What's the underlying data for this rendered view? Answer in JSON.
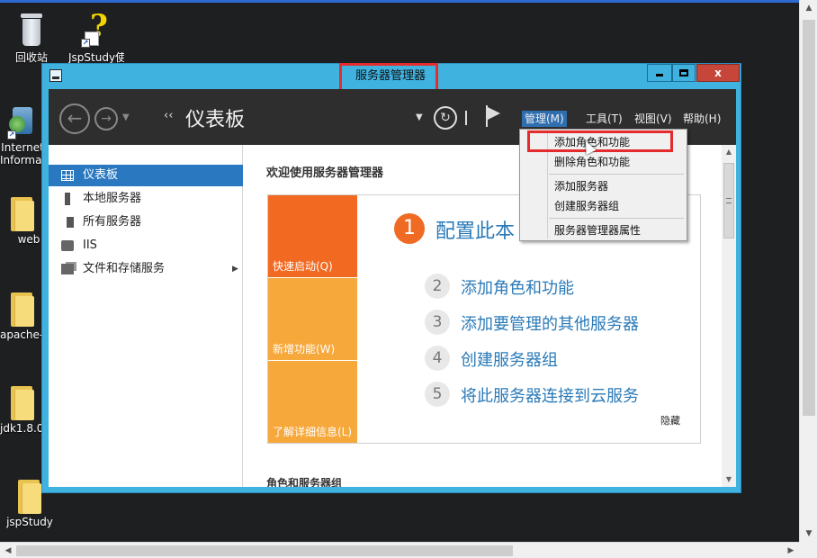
{
  "desktop": {
    "icons": [
      {
        "label": "回收站",
        "icon": "recycle-bin-icon"
      },
      {
        "label": "JspStudy使...",
        "icon": "jspstudy-shortcut-icon"
      },
      {
        "label": "Internet Information...",
        "icon": "iis-manager-icon"
      },
      {
        "label": "web",
        "icon": "folder-icon"
      },
      {
        "label": "apache-...",
        "icon": "folder-icon"
      },
      {
        "label": "jdk1.8.0...",
        "icon": "folder-icon"
      },
      {
        "label": "jspStudy",
        "icon": "folder-icon"
      }
    ]
  },
  "window": {
    "title": "服务器管理器",
    "buttons": {
      "minimize": "minimize",
      "maximize": "maximize",
      "close": "x"
    }
  },
  "toolbar": {
    "breadcrumb_arrow": "‹‹",
    "breadcrumb": "仪表板",
    "menu": [
      {
        "label": "管理(M)",
        "active": true
      },
      {
        "label": "工具(T)"
      },
      {
        "label": "视图(V)"
      },
      {
        "label": "帮助(H)"
      }
    ]
  },
  "nav": {
    "items": [
      {
        "label": "仪表板",
        "selected": true
      },
      {
        "label": "本地服务器"
      },
      {
        "label": "所有服务器"
      },
      {
        "label": "IIS"
      },
      {
        "label": "文件和存储服务",
        "has_children": true
      }
    ]
  },
  "main": {
    "welcome": "欢迎使用服务器管理器",
    "tiles": [
      "快速启动(Q)",
      "新增功能(W)",
      "了解详细信息(L)"
    ],
    "steps": [
      {
        "num": "1",
        "label": "配置此本"
      },
      {
        "num": "2",
        "label": "添加角色和功能"
      },
      {
        "num": "3",
        "label": "添加要管理的其他服务器"
      },
      {
        "num": "4",
        "label": "创建服务器组"
      },
      {
        "num": "5",
        "label": "将此服务器连接到云服务"
      }
    ],
    "hide": "隐藏",
    "roles_heading": "角色和服务器组"
  },
  "dropdown": {
    "items": [
      "添加角色和功能",
      "删除角色和功能",
      "添加服务器",
      "创建服务器组",
      "服务器管理器属性"
    ]
  },
  "colors": {
    "window_frame": "#3fb2e0",
    "toolbar_bg": "#2e2e2f",
    "nav_selected": "#2a79c0",
    "tile_orange": "#f26a21",
    "tile_amber": "#f7a83b",
    "link_blue": "#2a7ab8",
    "highlight_red": "#e52c2c"
  }
}
